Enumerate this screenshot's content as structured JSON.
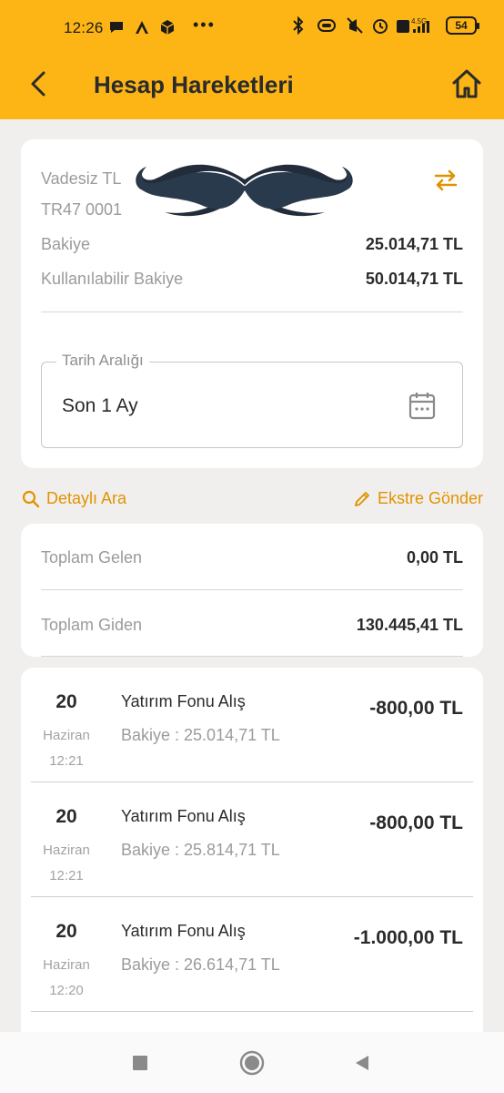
{
  "status_bar": {
    "time": "12:26",
    "network": "4.5G",
    "battery": "54"
  },
  "app_bar": {
    "title": "Hesap Hareketleri"
  },
  "account": {
    "name": "Vadesiz TL",
    "iban_partial": "TR47 0001",
    "balance_label": "Bakiye",
    "balance_value": "25.014,71 TL",
    "available_label": "Kullanılabilir Bakiye",
    "available_value": "50.014,71 TL"
  },
  "date_range": {
    "label": "Tarih Aralığı",
    "value": "Son 1 Ay"
  },
  "actions": {
    "detailed_search": "Detaylı Ara",
    "send_statement": "Ekstre Gönder"
  },
  "totals": {
    "incoming_label": "Toplam Gelen",
    "incoming_value": "0,00 TL",
    "outgoing_label": "Toplam Giden",
    "outgoing_value": "130.445,41 TL"
  },
  "transactions": [
    {
      "day": "20",
      "month": "Haziran",
      "time": "12:21",
      "title": "Yatırım Fonu Alış",
      "balance": "Bakiye : 25.014,71 TL",
      "amount": "-800,00 TL"
    },
    {
      "day": "20",
      "month": "Haziran",
      "time": "12:21",
      "title": "Yatırım Fonu Alış",
      "balance": "Bakiye : 25.814,71 TL",
      "amount": "-800,00 TL"
    },
    {
      "day": "20",
      "month": "Haziran",
      "time": "12:20",
      "title": "Yatırım Fonu Alış",
      "balance": "Bakiye : 26.614,71 TL",
      "amount": "-1.000,00 TL"
    }
  ],
  "colors": {
    "header_bg": "#fdb515",
    "accent": "#e09300",
    "page_bg": "#f1efed"
  },
  "icons": {
    "back": "chevron-left-icon",
    "home": "home-icon",
    "swap": "swap-arrows-icon",
    "calendar": "calendar-icon",
    "search": "search-icon",
    "edit": "pencil-icon"
  }
}
